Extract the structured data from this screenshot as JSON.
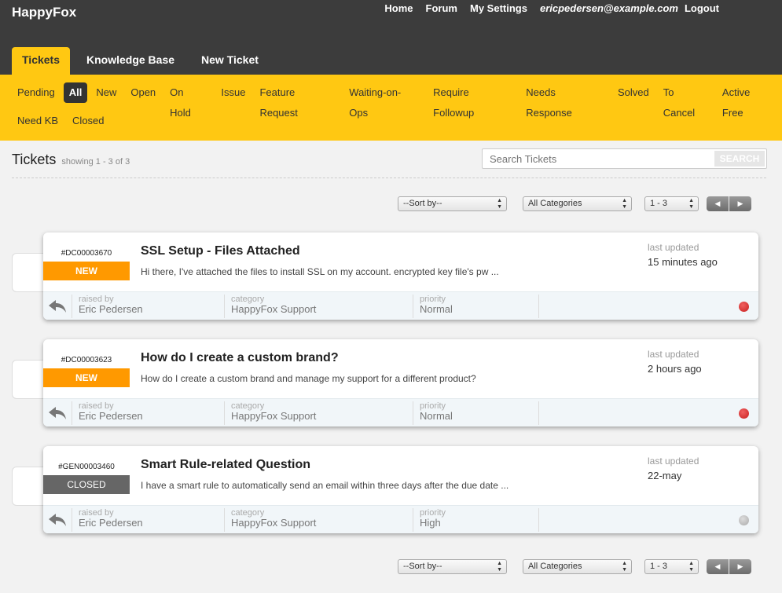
{
  "brand": "HappyFox",
  "top_nav": {
    "home": "Home",
    "forum": "Forum",
    "settings": "My Settings",
    "email": "ericpedersen@example.com",
    "logout": "Logout"
  },
  "main_tabs": [
    "Tickets",
    "Knowledge Base",
    "New Ticket"
  ],
  "filters": {
    "row1": [
      "Pending",
      "All",
      "New",
      "Open",
      "On Hold",
      "Issue",
      "Feature Request",
      "Waiting-on-Ops",
      "Require Followup",
      "Needs Response",
      "Solved",
      "To Cancel",
      "Active Free"
    ],
    "row2": [
      "Need KB",
      "Closed"
    ],
    "active": "All"
  },
  "list": {
    "title": "Tickets",
    "showing": "showing 1 - 3 of 3",
    "search_placeholder": "Search Tickets",
    "search_button": "SEARCH",
    "sort": "--Sort by--",
    "category": "All Categories",
    "range": "1 - 3"
  },
  "tickets": [
    {
      "id": "#DC00003670",
      "status": "NEW",
      "subject": "SSL Setup - Files Attached",
      "excerpt": "Hi there, I've attached the files to install SSL on my account. encrypted key file's pw ...",
      "updated_label": "last updated",
      "updated": "15 minutes ago",
      "raised_by_label": "raised by",
      "raised_by": "Eric Pedersen",
      "category_label": "category",
      "category": "HappyFox Support",
      "priority_label": "priority",
      "priority": "Normal",
      "indicator_color": "#d9302c"
    },
    {
      "id": "#DC00003623",
      "status": "NEW",
      "subject": "How do I create a custom brand?",
      "excerpt": "How do I create a custom brand and manage my support for a different product?",
      "updated_label": "last updated",
      "updated": "2 hours ago",
      "raised_by_label": "raised by",
      "raised_by": "Eric Pedersen",
      "category_label": "category",
      "category": "HappyFox Support",
      "priority_label": "priority",
      "priority": "Normal",
      "indicator_color": "#d9302c"
    },
    {
      "id": "#GEN00003460",
      "status": "CLOSED",
      "subject": "Smart Rule-related Question",
      "excerpt": "I have a smart rule to automatically send an email within three days after the due date  ...",
      "updated_label": "last updated",
      "updated": "22-may",
      "raised_by_label": "raised by",
      "raised_by": "Eric Pedersen",
      "category_label": "category",
      "category": "HappyFox Support",
      "priority_label": "priority",
      "priority": "High",
      "indicator_color": "#bbbbbb"
    }
  ],
  "colors": {
    "header_bg": "#3c3c3c",
    "accent_yellow": "#ffc812",
    "status_new": "#ff9900",
    "status_closed": "#666666"
  }
}
